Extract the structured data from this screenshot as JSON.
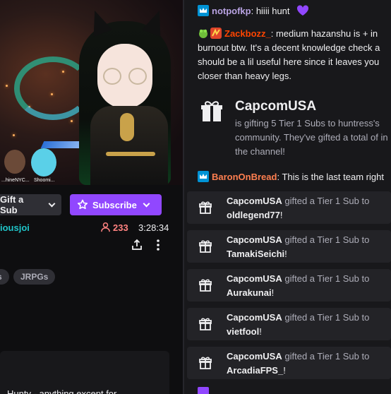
{
  "stream": {
    "overlay_counter": "1",
    "overlay_names": [
      "...hineNYC...",
      "Shoomi..."
    ]
  },
  "actions": {
    "gift_label": "Gift a Sub",
    "subscribe_label": "Subscribe"
  },
  "channel": {
    "name": "iousjoi",
    "viewers": "233",
    "uptime": "3:28:34"
  },
  "tags": [
    "s",
    "JRPGs"
  ],
  "panel": {
    "text": "Hunty - anything except for"
  },
  "chat": {
    "messages": [
      {
        "user": "notpofkp",
        "user_color": "#b9a3e3",
        "text": ": hiiii hunt",
        "emote": "purple-heart"
      },
      {
        "user": "Zackbozz_",
        "user_color": "#ff4500",
        "text": ": medium hazanshu is + in burnout btw. It's a decent knowledge check a should be a lil useful here since it leaves you closer than heavy legs."
      },
      {
        "user": "BaronOnBread",
        "user_color": "#ff7f50",
        "text": ": This is the last team right"
      }
    ],
    "gift_announcement": {
      "title": "CapcomUSA",
      "body": "is gifting 5 Tier 1 Subs to huntress's community. They've gifted a total of in the channel!"
    },
    "gift_subs": [
      {
        "gifter": "CapcomUSA",
        "action": "gifted a Tier 1 Sub to",
        "recipient": "oldlegend77"
      },
      {
        "gifter": "CapcomUSA",
        "action": "gifted a Tier 1 Sub to",
        "recipient": "TamakiSeichi"
      },
      {
        "gifter": "CapcomUSA",
        "action": "gifted a Tier 1 Sub to",
        "recipient": "Aurakunai"
      },
      {
        "gifter": "CapcomUSA",
        "action": "gifted a Tier 1 Sub to",
        "recipient": "vietfool"
      },
      {
        "gifter": "CapcomUSA",
        "action": "gifted a Tier 1 Sub to",
        "recipient": "ArcadiaFPS_"
      }
    ]
  },
  "colors": {
    "accent": "#9147ff",
    "channel_name": "#1fc5c9",
    "viewer_count": "#ff8280"
  }
}
